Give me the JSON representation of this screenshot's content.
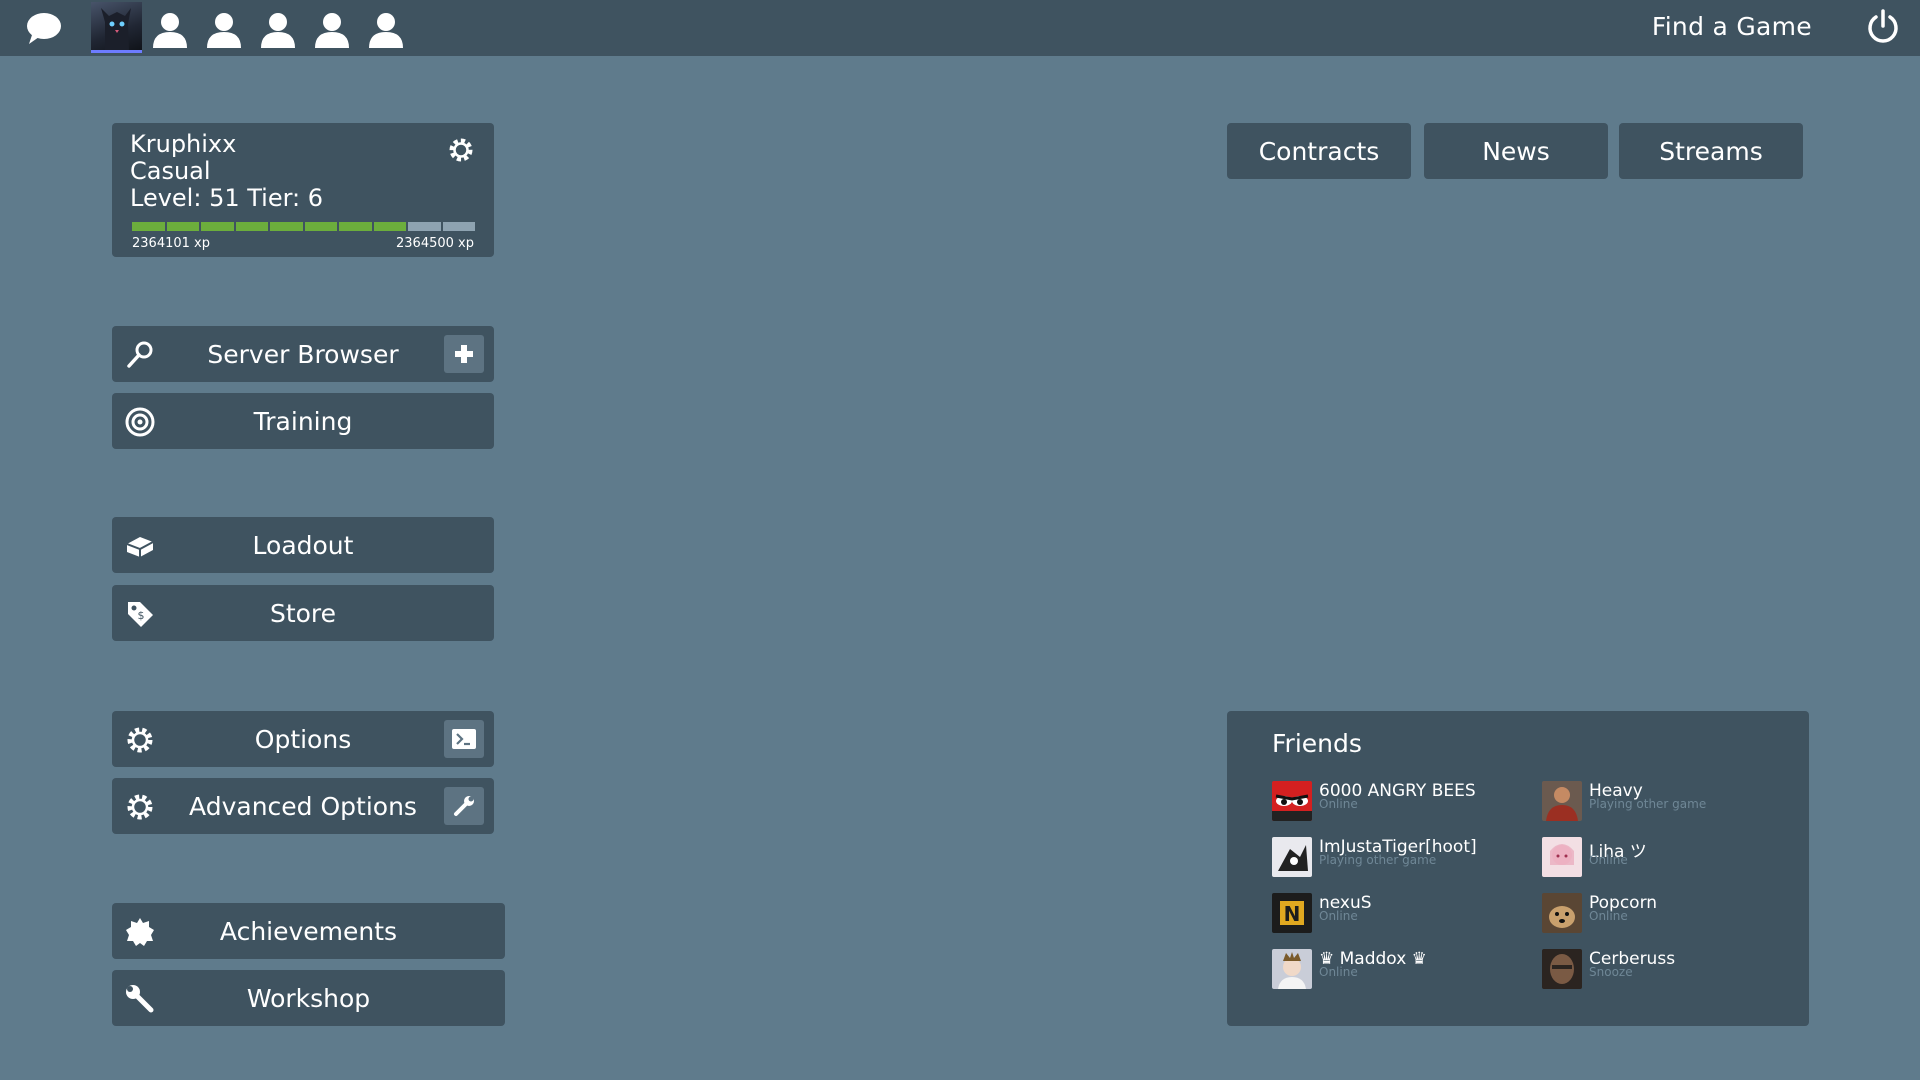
{
  "topbar": {
    "find_game": "Find a Game",
    "icons": [
      "chat-icon",
      "party-avatar",
      "party-slot-icon",
      "power-icon"
    ]
  },
  "profile": {
    "name": "Kruphixx",
    "mode": "Casual",
    "level_line": "Level: 51 Tier: 6",
    "xp_current": "2364101 xp",
    "xp_next": "2364500 xp",
    "xp_progress_segments_filled": 8,
    "xp_progress_segments_total": 10
  },
  "menu": {
    "server_browser": "Server Browser",
    "training": "Training",
    "loadout": "Loadout",
    "store": "Store",
    "options": "Options",
    "advanced_options": "Advanced Options",
    "achievements": "Achievements",
    "workshop": "Workshop"
  },
  "tabs": [
    "Contracts",
    "News",
    "Streams"
  ],
  "friends": {
    "title": "Friends",
    "list": [
      {
        "name": "6000 ANGRY BEES",
        "status": "Online"
      },
      {
        "name": "Heavy",
        "status": "Playing other game"
      },
      {
        "name": "ImJustaTiger[hoot]",
        "status": "Playing other game"
      },
      {
        "name": "Liha ツ",
        "status": "Online"
      },
      {
        "name": "nexuS",
        "status": "Online"
      },
      {
        "name": "Popcorn",
        "status": "Online"
      },
      {
        "name": "♛ Maddox ♛",
        "status": "Online"
      },
      {
        "name": "Cerberuss",
        "status": "Snooze"
      }
    ]
  },
  "colors": {
    "background": "#5f7b8c",
    "panel": "#3f5360",
    "xp_fill": "#6cae3c",
    "xp_empty": "#8ea3b1",
    "friend_status": "#6f8796",
    "avatar_accent": "#6d7cff"
  }
}
